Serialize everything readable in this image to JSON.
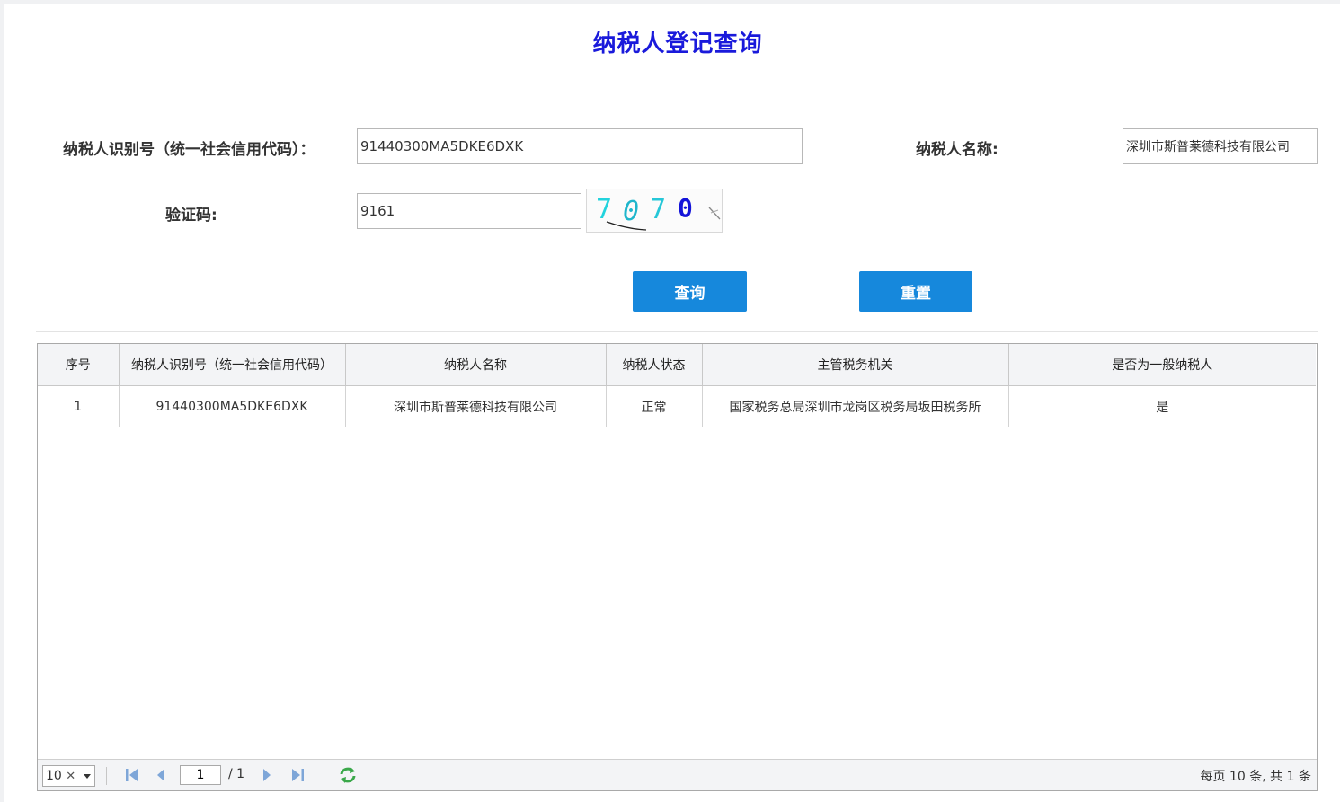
{
  "page": {
    "title": "纳税人登记查询"
  },
  "form": {
    "taxpayer_id_label": "纳税人识别号（统一社会信用代码）：",
    "taxpayer_id_value": "91440300MA5DKE6DXK",
    "taxpayer_name_label": "纳税人名称:",
    "taxpayer_name_value": "深圳市斯普莱德科技有限公司",
    "captcha_label": "验证码:",
    "captcha_value": "9161",
    "captcha_image_text": "7070",
    "query_button": "查询",
    "reset_button": "重置"
  },
  "table": {
    "columns": [
      "序号",
      "纳税人识别号（统一社会信用代码）",
      "纳税人名称",
      "纳税人状态",
      "主管税务机关",
      "是否为一般纳税人"
    ],
    "rows": [
      [
        "1",
        "91440300MA5DKE6DXK",
        "深圳市斯普莱德科技有限公司",
        "正常",
        "国家税务总局深圳市龙岗区税务局坂田税务所",
        "是"
      ]
    ]
  },
  "pager": {
    "page_size": "10",
    "current_page": "1",
    "total_pages": "/ 1",
    "summary": "每页 10 条, 共 1 条"
  },
  "colors": {
    "title": "#1a1adb",
    "button": "#1688dc",
    "header_bg": "#f3f4f6"
  },
  "icons": {
    "first": "first-page-icon",
    "prev": "prev-page-icon",
    "next": "next-page-icon",
    "last": "last-page-icon",
    "refresh": "refresh-icon"
  }
}
